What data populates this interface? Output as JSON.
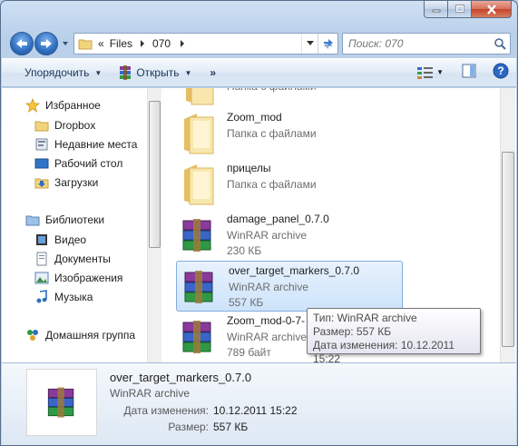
{
  "address": {
    "overflow": "«",
    "crumbs": [
      "Files",
      "070"
    ]
  },
  "search": {
    "placeholder": "Поиск: 070"
  },
  "toolbar": {
    "organize_label": "Упорядочить",
    "open_label": "Открыть",
    "more_label": "»"
  },
  "sidebar": {
    "favorites_label": "Избранное",
    "favorites": [
      "Dropbox",
      "Недавние места",
      "Рабочий стол",
      "Загрузки"
    ],
    "libraries_label": "Библиотеки",
    "libraries": [
      "Видео",
      "Документы",
      "Изображения",
      "Музыка"
    ],
    "homegroup_label": "Домашняя группа"
  },
  "files": [
    {
      "name": "",
      "type": "Папка с файлами",
      "size": "",
      "kind": "folder"
    },
    {
      "name": "Zoom_mod",
      "type": "Папка с файлами",
      "size": "",
      "kind": "folder"
    },
    {
      "name": "прицелы",
      "type": "Папка с файлами",
      "size": "",
      "kind": "folder"
    },
    {
      "name": "damage_panel_0.7.0",
      "type": "WinRAR archive",
      "size": "230 КБ",
      "kind": "archive"
    },
    {
      "name": "over_target_markers_0.7.0",
      "type": "WinRAR archive",
      "size": "557 КБ",
      "kind": "archive"
    },
    {
      "name": "Zoom_mod-0-7-",
      "type": "WinRAR archive",
      "size": "789 байт",
      "kind": "archive"
    }
  ],
  "tooltip": {
    "line1": "Тип: WinRAR archive",
    "line2": "Размер: 557 КБ",
    "line3": "Дата изменения: 10.12.2011 15:22"
  },
  "details": {
    "name": "over_target_markers_0.7.0",
    "type": "WinRAR archive",
    "modified_label": "Дата изменения:",
    "modified_value": "10.12.2011 15:22",
    "size_label": "Размер:",
    "size_value": "557 КБ"
  },
  "colors": {
    "accent": "#2f6ec0",
    "selection": "#cde3fb",
    "folder": "#f2d47c"
  }
}
